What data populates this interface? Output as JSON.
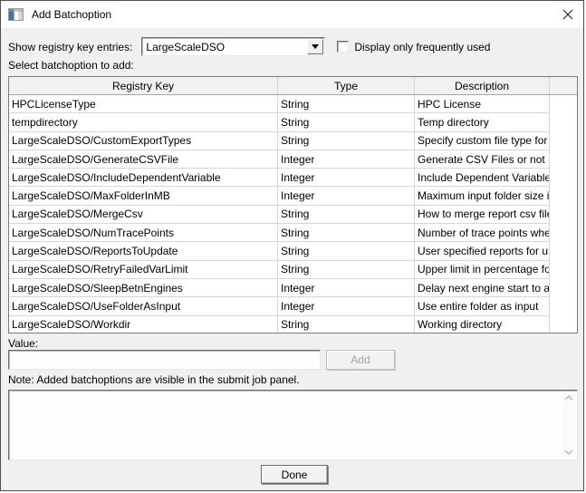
{
  "window": {
    "title": "Add Batchoption"
  },
  "filter": {
    "label": "Show registry key entries:",
    "dropdown_value": "LargeScaleDSO",
    "checkbox_label": "Display only frequently used",
    "checkbox_checked": false
  },
  "table": {
    "caption": "Select batchoption to add:",
    "columns": [
      "Registry Key",
      "Type",
      "Description"
    ],
    "rows": [
      [
        "HPCLicenseType",
        "String",
        "HPC License"
      ],
      [
        "tempdirectory",
        "String",
        "Temp directory"
      ],
      [
        "LargeScaleDSO/CustomExportTypes",
        "String",
        "Specify custom file type for ..."
      ],
      [
        "LargeScaleDSO/GenerateCSVFile",
        "Integer",
        "Generate CSV Files or not"
      ],
      [
        "LargeScaleDSO/IncludeDependentVariable",
        "Integer",
        "Include Dependent Variable ..."
      ],
      [
        "LargeScaleDSO/MaxFolderInMB",
        "Integer",
        "Maximum input folder size in..."
      ],
      [
        "LargeScaleDSO/MergeCsv",
        "String",
        "How to merge report csv files"
      ],
      [
        "LargeScaleDSO/NumTracePoints",
        "String",
        "Number of trace points whe..."
      ],
      [
        "LargeScaleDSO/ReportsToUpdate",
        "String",
        "User specified reports for u..."
      ],
      [
        "LargeScaleDSO/RetryFailedVarLimit",
        "String",
        "Upper limit in percentage fo..."
      ],
      [
        "LargeScaleDSO/SleepBetnEngines",
        "Integer",
        "Delay next engine start to a..."
      ],
      [
        "LargeScaleDSO/UseFolderAsInput",
        "Integer",
        "Use entire folder as input"
      ],
      [
        "LargeScaleDSO/Workdir",
        "String",
        "Working directory"
      ]
    ]
  },
  "value_section": {
    "label": "Value:",
    "input_value": "",
    "add_button": "Add"
  },
  "note": {
    "text": "Note: Added batchoptions are visible in the submit job panel."
  },
  "footer": {
    "done_button": "Done"
  },
  "colors": {
    "dialog_background": "#f0f0f0",
    "titlebar_background": "#ffffff",
    "table_border": "#7a7a7a",
    "row_separator": "#d6d6d6",
    "disabled_text": "#a3a3a3"
  }
}
